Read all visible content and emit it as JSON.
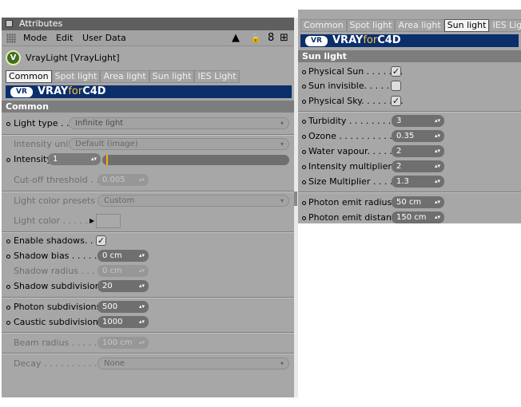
{
  "left_panel": {
    "title": "Attributes",
    "menu": {
      "mode": "Mode",
      "edit": "Edit",
      "user_data": "User Data"
    },
    "menu_icons": [
      "up-arrow-icon",
      "lock-icon",
      "link-icon",
      "new-panel-icon"
    ],
    "object_name": "VrayLight [VrayLight]",
    "logo_glyph": "V",
    "tabs": [
      "Common",
      "Spot light",
      "Area light",
      "Sun light",
      "IES Light"
    ],
    "active_tab": "Common",
    "banner": {
      "mark": "VR",
      "vray": "VRAY",
      "for": "for",
      "c4d": "C4D"
    },
    "section": "Common",
    "light_type": {
      "label": "Light type . . .",
      "value": "Infinite light"
    },
    "intensity_units": {
      "label": "Intensity units",
      "value": "Default (image)"
    },
    "intensity": {
      "label": "Intensity",
      "value": "1",
      "slider_level": 0.02
    },
    "cutoff": {
      "label": "Cut-off threshold . .",
      "value": "0.005"
    },
    "light_color_presets": {
      "label": "Light color presets . . .",
      "value": "Custom"
    },
    "light_color": {
      "label": "Light color . . . . . .",
      "swatch_color": "#a9a9a9"
    },
    "enable_shadows": {
      "label": "Enable shadows. . . .",
      "checked": true
    },
    "shadow_bias": {
      "label": "Shadow bias . . . . . .",
      "value": "0 cm"
    },
    "shadow_radius": {
      "label": "Shadow radius . . . . .",
      "value": "0 cm"
    },
    "shadow_subdivisions": {
      "label": "Shadow subdivisions",
      "value": "20"
    },
    "photon_subdivisions": {
      "label": "Photon subdivisions",
      "value": "500"
    },
    "caustic_subdivisions": {
      "label": "Caustic subdivisions",
      "value": "1000"
    },
    "beam_radius": {
      "label": "Beam radius . . . . . . .",
      "value": "100 cm"
    },
    "decay": {
      "label": "Decay . . . . . . . . . . . .",
      "value": "None"
    }
  },
  "right_panel": {
    "tabs": [
      "Common",
      "Spot light",
      "Area light",
      "Sun light",
      "IES Light"
    ],
    "active_tab": "Sun light",
    "banner": {
      "mark": "VR",
      "vray": "VRAY",
      "for": "for",
      "c4d": "C4D"
    },
    "section": "Sun light",
    "physical_sun": {
      "label": "Physical Sun . . . . . . .",
      "checked": true
    },
    "sun_invisible": {
      "label": "Sun invisible. . . . . . .",
      "checked": false
    },
    "physical_sky": {
      "label": "Physical Sky. . . . . . . .",
      "checked": true
    },
    "turbidity": {
      "label": "Turbidity . . . . . . . . . .",
      "value": "3"
    },
    "ozone": {
      "label": "Ozone . . . . . . . . . . . .",
      "value": "0.35"
    },
    "water_vapour": {
      "label": "Water vapour. . . . . . .",
      "value": "2"
    },
    "intensity_multiplier": {
      "label": "Intensity multiplier . .",
      "value": "2"
    },
    "size_multiplier": {
      "label": "Size Multiplier . . . . . .",
      "value": "1.3"
    },
    "photon_emit_radius": {
      "label": "Photon emit radius . .",
      "value": "50 cm"
    },
    "photon_emit_distance": {
      "label": "Photon emit distance",
      "value": "150 cm"
    }
  },
  "check_glyph": "✓",
  "spin_glyph": "▴▾",
  "drop_glyph": "▾",
  "color_arrow_glyph": "▶",
  "icon_glyphs": {
    "up": "▲",
    "lock": "🔒",
    "link": "8",
    "new_panel": "⊞"
  }
}
